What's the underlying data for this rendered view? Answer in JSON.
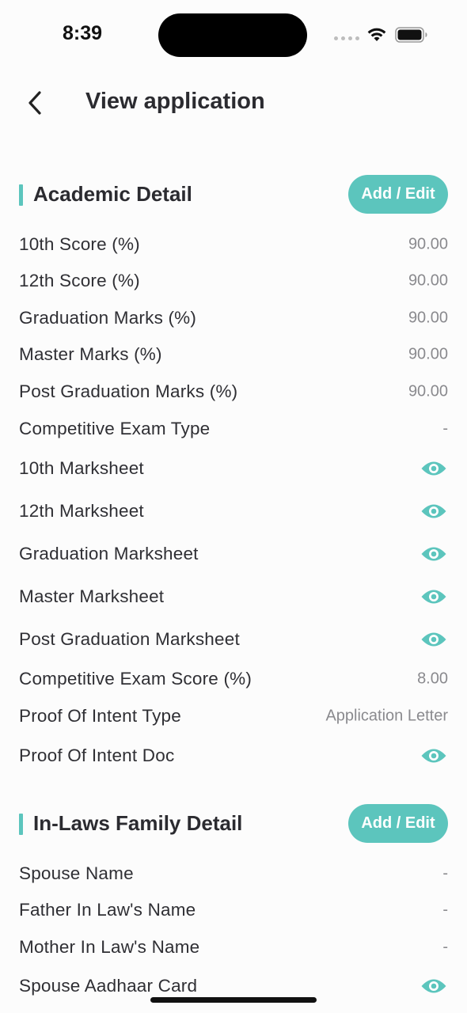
{
  "status_bar": {
    "time": "8:39",
    "icons": [
      "signal-dots-icon",
      "wifi-icon",
      "battery-icon"
    ]
  },
  "header": {
    "title": "View application",
    "back_icon": "chevron-left-icon"
  },
  "colors": {
    "accent": "#5cc5bd",
    "text_primary": "#2f2f34",
    "text_secondary": "#8a8a8e",
    "background": "#fcfcfc"
  },
  "academic": {
    "title": "Academic Detail",
    "button": "Add / Edit",
    "rows": [
      {
        "label": "10th Score (%)",
        "value": "90.00"
      },
      {
        "label": "12th Score (%)",
        "value": "90.00"
      },
      {
        "label": "Graduation Marks (%)",
        "value": "90.00"
      },
      {
        "label": "Master Marks (%)",
        "value": "90.00"
      },
      {
        "label": "Post Graduation Marks (%)",
        "value": "90.00"
      },
      {
        "label": "Competitive Exam Type",
        "value": "-"
      },
      {
        "label": "10th Marksheet",
        "icon": "eye-icon"
      },
      {
        "label": "12th Marksheet",
        "icon": "eye-icon"
      },
      {
        "label": "Graduation Marksheet",
        "icon": "eye-icon"
      },
      {
        "label": "Master Marksheet",
        "icon": "eye-icon"
      },
      {
        "label": "Post Graduation Marksheet",
        "icon": "eye-icon"
      },
      {
        "label": "Competitive Exam Score (%)",
        "value": "8.00"
      },
      {
        "label": "Proof Of Intent Type",
        "value": "Application Letter"
      },
      {
        "label": "Proof Of Intent Doc",
        "icon": "eye-icon"
      }
    ]
  },
  "in_laws": {
    "title": "In-Laws Family Detail",
    "button": "Add / Edit",
    "rows": [
      {
        "label": "Spouse Name",
        "value": "-"
      },
      {
        "label": "Father In Law's Name",
        "value": "-"
      },
      {
        "label": "Mother In Law's Name",
        "value": "-"
      },
      {
        "label": "Spouse Aadhaar Card",
        "icon": "eye-icon"
      }
    ]
  }
}
